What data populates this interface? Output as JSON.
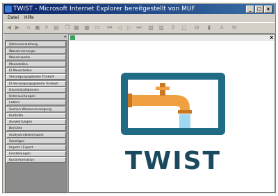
{
  "window": {
    "title": "TWIST - Microsoft Internet Explorer bereitgestellt von MUF",
    "controls": {
      "minimize": "_",
      "maximize": "□",
      "close": "x"
    }
  },
  "menu": [
    "Datei",
    "Hilfe"
  ],
  "toolbar_icons": [
    "back-icon",
    "forward-icon",
    "new-icon",
    "save-icon",
    "delete-icon",
    "print-icon",
    "copy-icon",
    "paste-icon",
    "grid-icon",
    "form-icon",
    "first-icon",
    "prev-icon",
    "next-icon",
    "last-icon",
    "filter-icon",
    "sort-icon",
    "search-icon",
    "zoom-icon",
    "tools-icon",
    "lock-icon",
    "help-icon"
  ],
  "sidebar": {
    "collapse": "«",
    "items": [
      "Adressverwaltung",
      "Wasserversorger",
      "Wasserwerke",
      "Messstellen",
      "EI Messstellen",
      "Versorgungsgebiete TrinkwV",
      "EI Versorgungsgebiete TrinkwV",
      "Hausinstallationen",
      "Untersuchungen",
      "Labors",
      "Sachen Wasserversorgung",
      "Kontrolle",
      "Auswertungen",
      "Berichte",
      "Analysendatenimport",
      "Sonstiges",
      "Import / Export",
      "Einstellungen",
      "Kurzinformation"
    ]
  },
  "content": {
    "close": "x",
    "logo_text": "TWIST"
  },
  "colors": {
    "logo_blue": "#1f6c84",
    "logo_dark": "#1b4a5e",
    "faucet_orange": "#f0a040",
    "water_blue": "#9fd8f0"
  }
}
